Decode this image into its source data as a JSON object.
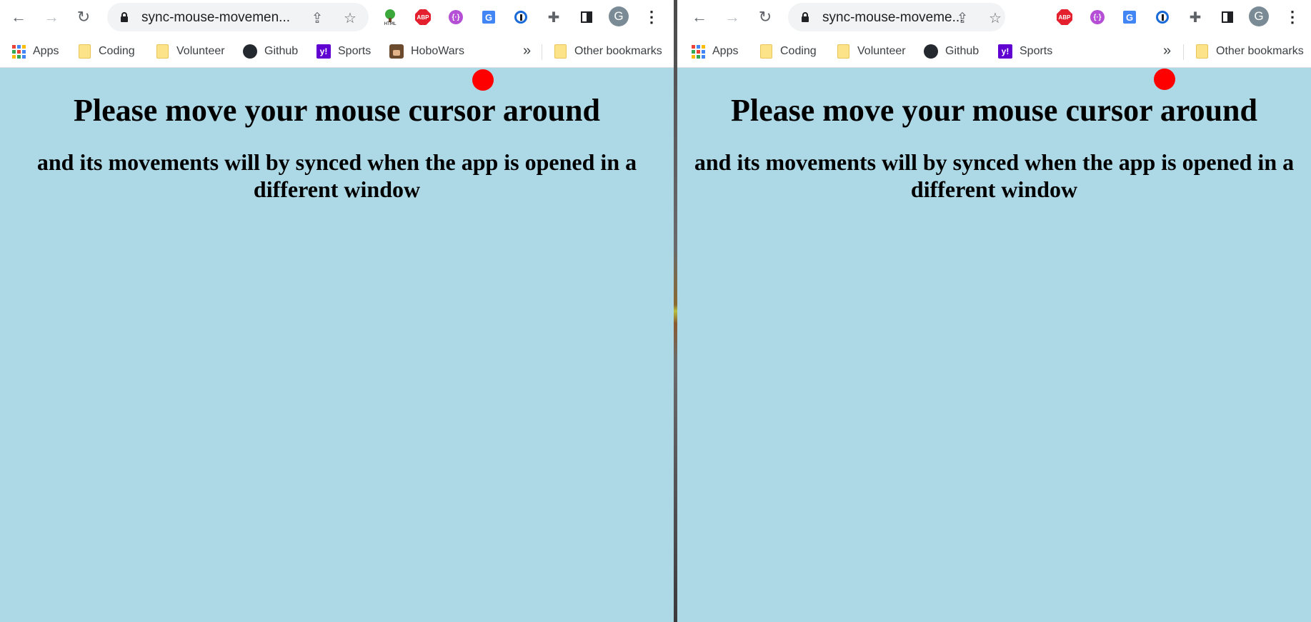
{
  "left_window": {
    "url": "sync-mouse-movemen...",
    "bookmarks": [
      "Apps",
      "Coding",
      "Volunteer",
      "Github",
      "Sports",
      "HoboWars"
    ],
    "other_bookmarks": "Other bookmarks",
    "profile_initial": "G",
    "page": {
      "heading": "Please move your mouse cursor around",
      "subheading": "and its movements will by synced when the app is opened in a different window"
    }
  },
  "right_window": {
    "url": "sync-mouse-moveme...",
    "bookmarks": [
      "Apps",
      "Coding",
      "Volunteer",
      "Github",
      "Sports"
    ],
    "other_bookmarks": "Other bookmarks",
    "profile_initial": "G",
    "page": {
      "heading": "Please move your mouse cursor around",
      "subheading": "and its movements will by synced when the app is opened in a different window"
    }
  },
  "icons": {
    "back": "back-arrow-icon",
    "forward": "forward-arrow-icon",
    "reload": "reload-icon",
    "lock": "lock-icon",
    "share": "share-icon",
    "star": "bookmark-star-icon",
    "extensions": [
      "html-tree-icon",
      "adblock-plus-icon",
      "purple-extension-icon",
      "google-translate-icon",
      "1password-icon",
      "puzzle-icon",
      "side-panel-icon"
    ],
    "menu": "kebab-menu-icon"
  },
  "colors": {
    "page_background": "#add8e6",
    "cursor_dot": "#ff0000",
    "toolbar": "#ffffff",
    "omnibox": "#f1f3f4",
    "avatar": "#7b8b95"
  }
}
